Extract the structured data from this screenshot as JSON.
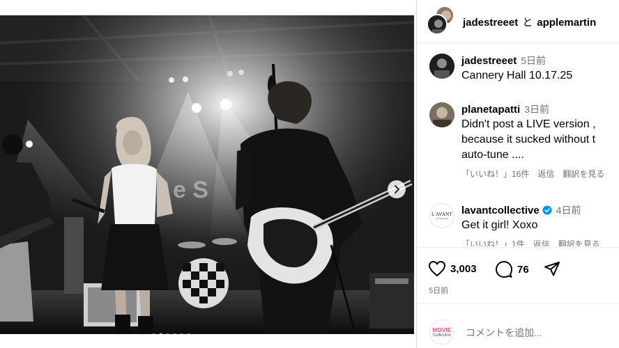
{
  "header": {
    "user1": "jadestreeet",
    "connector": "と",
    "user2": "applemartin"
  },
  "comments": [
    {
      "username": "jadestreeet",
      "time": "5日前",
      "text": "Cannery Hall 10.17.25",
      "meta": []
    },
    {
      "username": "planetapatti",
      "time": "3日前",
      "text": "Didn't post a LIVE version ,\nbecause it sucked without t\nauto-tune ....",
      "meta": [
        "「いいね！」16件",
        "返信",
        "翻訳を見る"
      ]
    },
    {
      "username": "lavantcollective",
      "verified": true,
      "time": "4日前",
      "text": "Get it girl! Xoxo",
      "meta": [
        "「いいね！」1件",
        "返信",
        "翻訳を見る"
      ],
      "avatar_text": "L'AVANT",
      "avatar_subtext": "COLLECTIVE"
    }
  ],
  "actions": {
    "likes": "3,003",
    "comments": "76",
    "posted": "5日前",
    "icons": [
      "heart-icon",
      "comment-icon",
      "share-icon"
    ]
  },
  "composer": {
    "placeholder": "コメントを追加...",
    "avatar_line1": "MOVIE",
    "avatar_line2": "Collection"
  },
  "media": {
    "slides": 6,
    "active_slide": 2,
    "description_icons": [
      "chevron-right-icon"
    ]
  },
  "colors": {
    "verified": "#0095f6",
    "muted": "#737373",
    "border": "#dbdbdb"
  }
}
